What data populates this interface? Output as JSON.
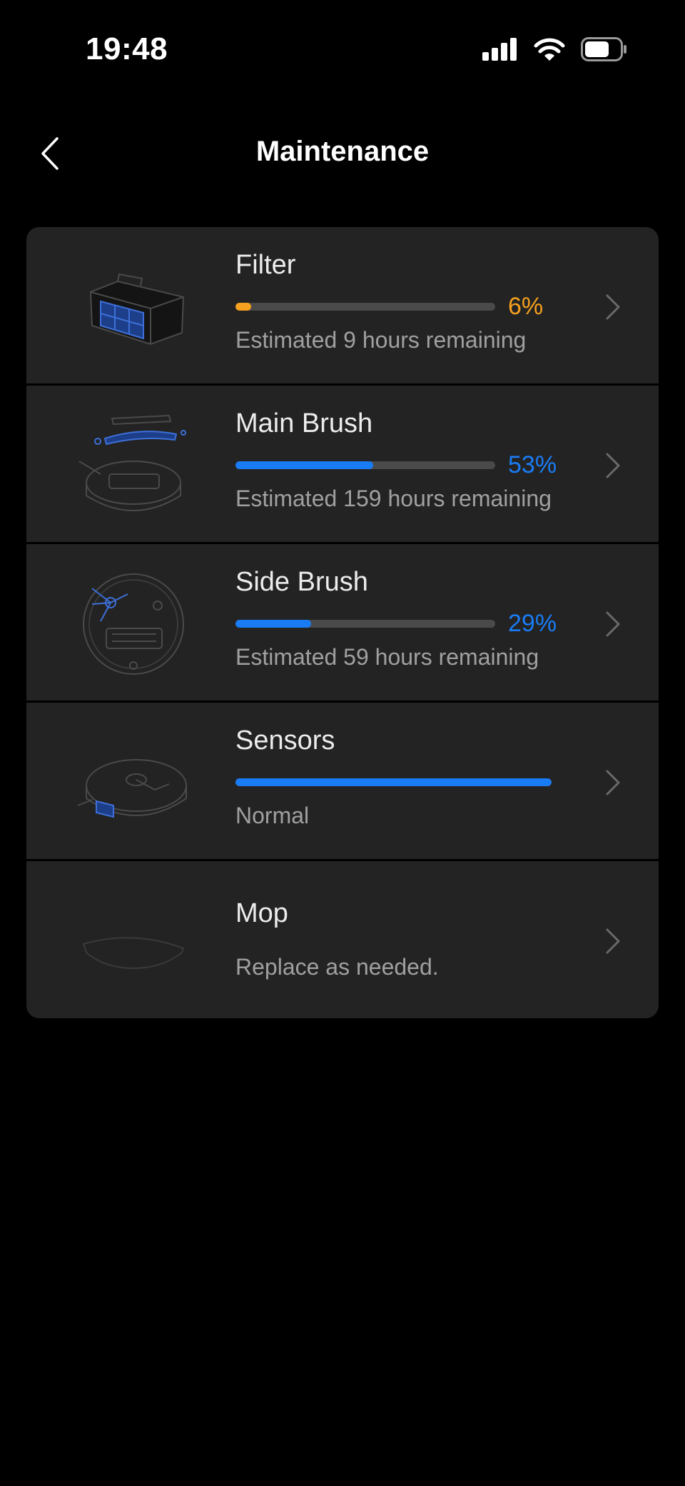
{
  "status_bar": {
    "time": "19:48",
    "signal_icon": "cellular-signal-icon",
    "wifi_icon": "wifi-icon",
    "battery_icon": "battery-icon"
  },
  "nav": {
    "title": "Maintenance",
    "back_icon": "chevron-left-icon"
  },
  "colors": {
    "blue": "#1a7cf5",
    "orange": "#f5a01e",
    "track": "#4a4a4a",
    "card": "#232323"
  },
  "items": [
    {
      "name": "Filter",
      "progress": 0.06,
      "percent_label": "6%",
      "status": "Estimated 9 hours remaining",
      "color": "#f5a01e",
      "icon": "filter-icon"
    },
    {
      "name": "Main Brush",
      "progress": 0.53,
      "percent_label": "53%",
      "status": "Estimated 159 hours remaining",
      "color": "#1a7cf5",
      "icon": "main-brush-icon"
    },
    {
      "name": "Side Brush",
      "progress": 0.29,
      "percent_label": "29%",
      "status": "Estimated 59 hours remaining",
      "color": "#1a7cf5",
      "icon": "side-brush-icon"
    },
    {
      "name": "Sensors",
      "progress": 1.0,
      "status": "Normal",
      "color": "#1a7cf5",
      "icon": "sensors-icon"
    },
    {
      "name": "Mop",
      "status": "Replace as needed.",
      "icon": "mop-icon"
    }
  ]
}
